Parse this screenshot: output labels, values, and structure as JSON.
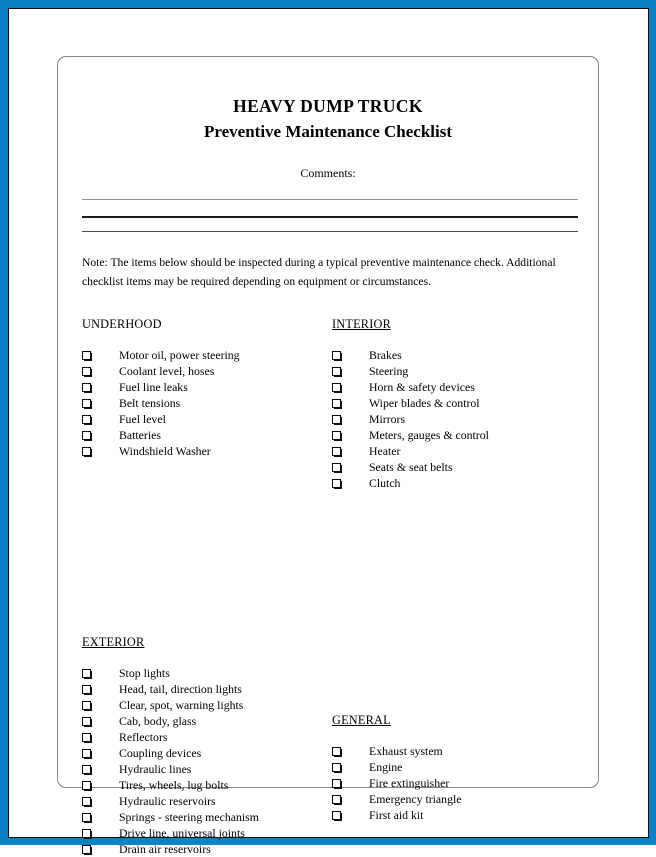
{
  "page": {
    "frame_color": "#0b82c6",
    "card_border_color": "#838383",
    "background": "#ffffff"
  },
  "document": {
    "title_main": "HEAVY DUMP TRUCK",
    "title_sub": "Preventive Maintenance Checklist",
    "comments_label": "Comments:",
    "comment_lines": [
      "",
      "",
      ""
    ],
    "note": "Note: The items below should be inspected during a typical preventive maintenance check. Additional checklist items may be required depending on equipment or circumstances."
  },
  "sections": {
    "underhood": {
      "heading": "UNDERHOOD",
      "underlined": false,
      "items": [
        "Motor oil, power steering",
        "Coolant level, hoses",
        "Fuel line leaks",
        "Belt tensions",
        "Fuel level",
        "Batteries",
        "Windshield Washer"
      ]
    },
    "exterior": {
      "heading": "EXTERIOR",
      "underlined": true,
      "items": [
        "Stop lights",
        "Head, tail, direction lights",
        "Clear, spot, warning lights",
        "Cab, body, glass",
        "Reflectors",
        "Coupling devices",
        "Hydraulic lines",
        "Tires, wheels, lug bolts",
        "Hydraulic reservoirs",
        "Springs - steering mechanism",
        "Drive line, universal joints",
        "Drain air reservoirs"
      ]
    },
    "interior": {
      "heading": "INTERIOR",
      "underlined": true,
      "items": [
        "Brakes",
        "Steering",
        "Horn & safety devices",
        "Wiper blades & control",
        "Mirrors",
        "Meters, gauges & control",
        "Heater",
        "Seats & seat belts",
        "Clutch"
      ]
    },
    "general": {
      "heading": "GENERAL",
      "underlined": true,
      "items": [
        "Exhaust system",
        "Engine",
        "Fire extinguisher",
        "Emergency triangle",
        "First aid kit"
      ]
    }
  }
}
